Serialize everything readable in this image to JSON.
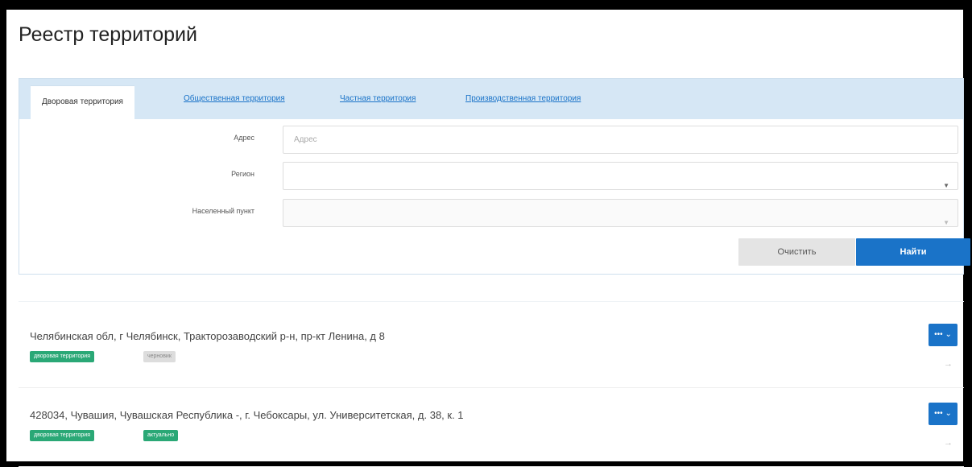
{
  "page": {
    "title": "Реестр территорий"
  },
  "tabs": [
    {
      "label": "Дворовая территория",
      "active": true
    },
    {
      "label": "Общественная территория",
      "active": false
    },
    {
      "label": "Частная территория",
      "active": false
    },
    {
      "label": "Производственная территория",
      "active": false
    }
  ],
  "filters": {
    "address": {
      "label": "Адрес",
      "placeholder": "Адрес",
      "value": ""
    },
    "region": {
      "label": "Регион",
      "value": ""
    },
    "locality": {
      "label": "Населенный пункт",
      "value": ""
    }
  },
  "buttons": {
    "clear_label": "Очистить",
    "find_label": "Найти"
  },
  "results": [
    {
      "address": "Челябинская обл, г Челябинск, Тракторозаводский р-н, пр-кт Ленина, д 8",
      "badges": [
        {
          "text": "дворовая территория",
          "color": "#2aa876"
        },
        {
          "text": "черновик",
          "color": "#dddddd"
        }
      ],
      "actions_label": "••• ⌄"
    },
    {
      "address": "428034, Чувашия, Чувашская Республика -, г. Чебоксары, ул. Университетская, д. 38, к. 1",
      "badges": [
        {
          "text": "дворовая территория",
          "color": "#2aa876"
        },
        {
          "text": "актуально",
          "color": "#2aa876"
        }
      ],
      "actions_label": "••• ⌄"
    }
  ],
  "colors": {
    "accent": "#1a73c8",
    "tab_bar": "#d6e7f5",
    "badge_green": "#2aa876"
  }
}
